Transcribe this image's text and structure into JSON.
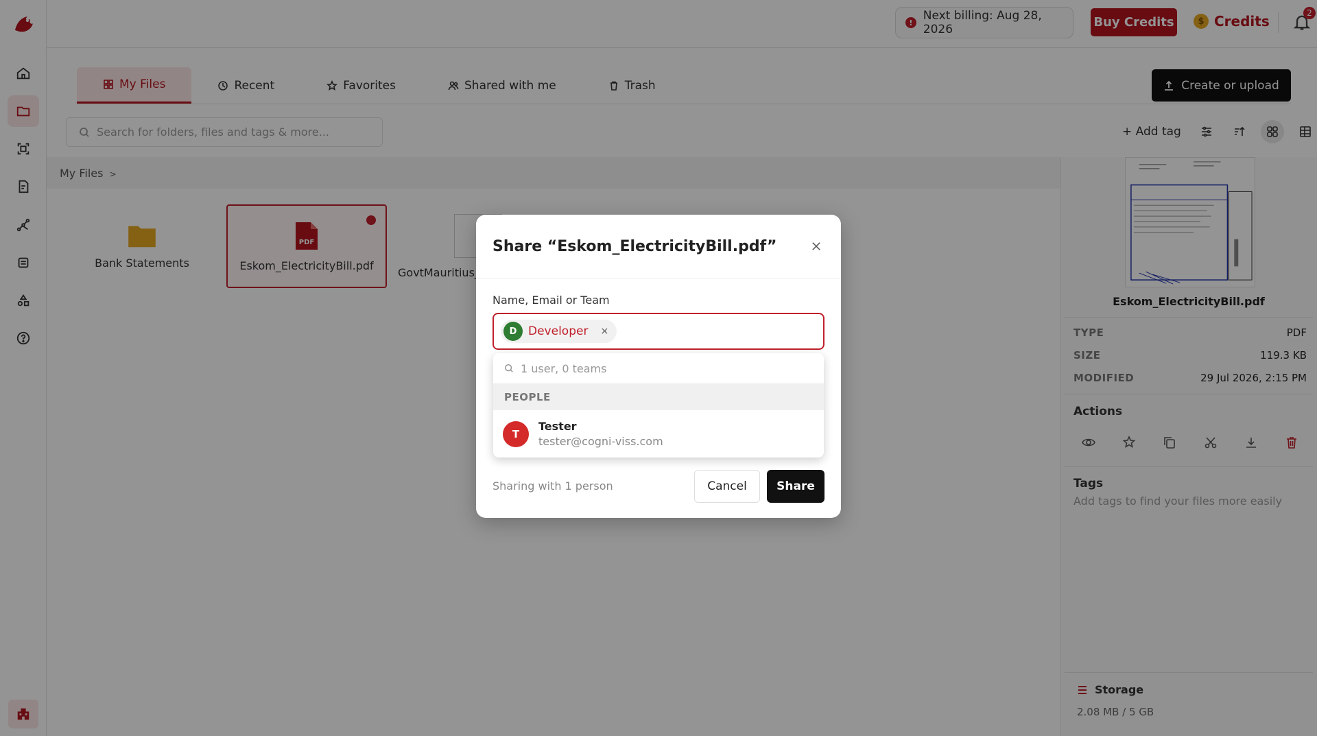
{
  "topbar": {
    "billing_text": "Next billing: Aug 28, 2026",
    "billing_icon": "!",
    "buy_credits_label": "Buy Credits",
    "credits_label": "Credits",
    "coin_symbol": "$",
    "notification_count": "2"
  },
  "tabs": [
    {
      "label": "My Files",
      "icon": "grid-icon"
    },
    {
      "label": "Recent",
      "icon": "clock-icon"
    },
    {
      "label": "Favorites",
      "icon": "star-icon"
    },
    {
      "label": "Shared with me",
      "icon": "users-icon"
    },
    {
      "label": "Trash",
      "icon": "trash-icon"
    }
  ],
  "create_label": "Create or upload",
  "search": {
    "placeholder": "Search for folders, files and tags & more..."
  },
  "toolbar": {
    "add_tag_label": "+ Add tag"
  },
  "breadcrumb": {
    "root": "My Files",
    "sep": ">"
  },
  "files": [
    {
      "name": "Bank Statements",
      "type": "folder"
    },
    {
      "name": "Eskom_ElectricityBill.pdf",
      "type": "pdf",
      "badge": "PDF"
    },
    {
      "name": "GovtMauritius_",
      "type": "image"
    }
  ],
  "details": {
    "filename": "Eskom_ElectricityBill.pdf",
    "rows": [
      {
        "key": "TYPE",
        "value": "PDF"
      },
      {
        "key": "SIZE",
        "value": "119.3 KB"
      },
      {
        "key": "MODIFIED",
        "value": "29 Jul 2026, 2:15 PM"
      }
    ],
    "actions_heading": "Actions",
    "tags_heading": "Tags",
    "tags_hint": "Add tags to find your files more easily",
    "storage_heading": "Storage",
    "storage_value": "2.08 MB / 5 GB"
  },
  "modal": {
    "title": "Share “Eskom_ElectricityBill.pdf”",
    "field_label": "Name, Email or Team",
    "chip": {
      "initial": "D",
      "name": "Developer",
      "remove": "×"
    },
    "dropdown": {
      "search_placeholder": "1 user, 0 teams",
      "group_label": "PEOPLE",
      "people": [
        {
          "initial": "T",
          "name": "Tester",
          "email": "tester@cogni-viss.com"
        }
      ]
    },
    "footer_text": "Sharing with 1 person",
    "cancel_label": "Cancel",
    "share_label": "Share"
  },
  "colors": {
    "brand": "#b3161f",
    "dark": "#111111",
    "chip_avatar": "#2e7d32"
  }
}
